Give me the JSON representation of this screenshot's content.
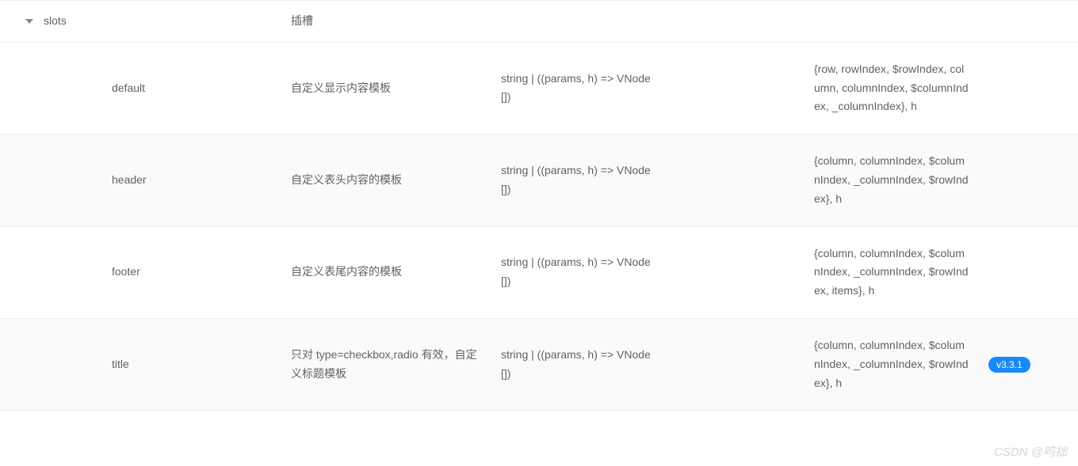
{
  "header": {
    "name": "slots",
    "desc": "插槽"
  },
  "rows": [
    {
      "name": "default",
      "desc": "自定义显示内容模板",
      "type": "string | ((params, h) => VNode[])",
      "params": "{row, rowIndex, $rowIndex, column, columnIndex, $columnIndex, _columnIndex}, h",
      "version": ""
    },
    {
      "name": "header",
      "desc": "自定义表头内容的模板",
      "type": "string | ((params, h) => VNode[])",
      "params": "{column, columnIndex, $columnIndex, _columnIndex, $rowIndex}, h",
      "version": ""
    },
    {
      "name": "footer",
      "desc": "自定义表尾内容的模板",
      "type": "string | ((params, h) => VNode[])",
      "params": "{column, columnIndex, $columnIndex, _columnIndex, $rowIndex, items}, h",
      "version": ""
    },
    {
      "name": "title",
      "desc": "只对 type=checkbox,radio 有效，自定义标题模板",
      "type": "string | ((params, h) => VNode[])",
      "params": "{column, columnIndex, $columnIndex, _columnIndex, $rowIndex}, h",
      "version": "v3.3.1"
    }
  ],
  "watermark": "CSDN @呜拙"
}
